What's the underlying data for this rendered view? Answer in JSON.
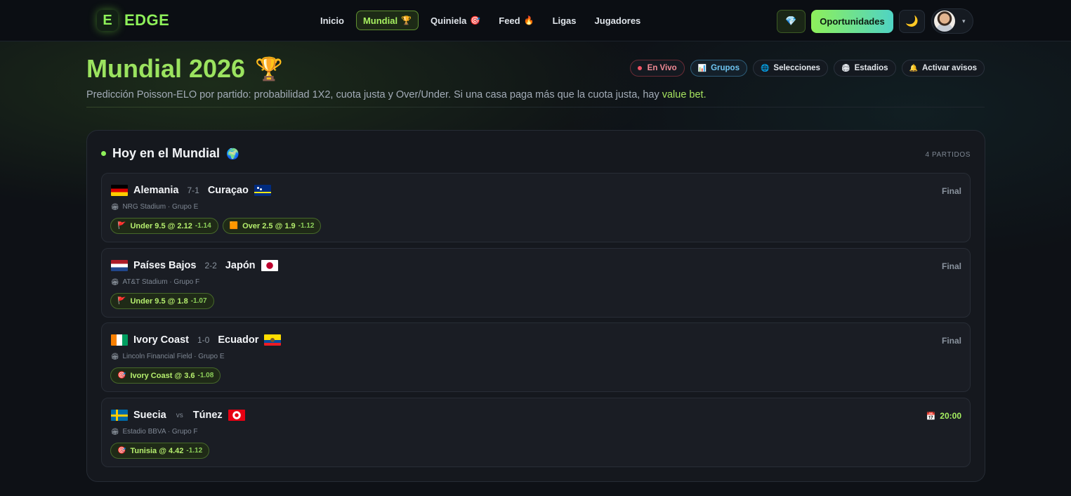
{
  "nav": {
    "logo_letter": "E",
    "logo_text": "EDGE",
    "items": [
      {
        "label": "Inicio",
        "emoji": ""
      },
      {
        "label": "Mundial",
        "emoji": "🏆"
      },
      {
        "label": "Quiniela",
        "emoji": "🎯"
      },
      {
        "label": "Feed",
        "emoji": "🔥"
      },
      {
        "label": "Ligas",
        "emoji": ""
      },
      {
        "label": "Jugadores",
        "emoji": ""
      }
    ],
    "active_item": "Mundial",
    "gem_icon": "💎",
    "opportunities_label": "Oportunidades",
    "moon_icon": "🌙",
    "caret": "▾"
  },
  "header": {
    "title": "Mundial 2026",
    "title_icon": "🏆",
    "subtitle_main": "Predicción Poisson-ELO por partido: probabilidad 1X2, cuota justa y Over/Under. Si una casa paga más que la cuota justa, hay ",
    "subtitle_highlight": "value bet.",
    "chips": {
      "live": "En Vivo",
      "groups": "Grupos",
      "groups_icon": "📊",
      "selections": "Selecciones",
      "selections_icon": "🌐",
      "stadiums": "Estadios",
      "stadiums_icon": "🏟",
      "alerts": "Activar avisos",
      "alerts_icon": "🔔"
    }
  },
  "today": {
    "title": "Hoy en el Mundial",
    "title_icon": "🌍",
    "count": "4 PARTIDOS",
    "venue_icon": "🏟",
    "matches": [
      {
        "home": "Alemania",
        "home_flag": "germany-flag",
        "score": "7-1",
        "away": "Curaçao",
        "away_flag": "curacao-flag",
        "venue": "NRG Stadium · Grupo E",
        "status": "Final",
        "tags": [
          {
            "icon": "🚩",
            "text": "Under 9.5 @ 2.12",
            "ev": "-1.14"
          },
          {
            "icon": "🟧",
            "text": "Over 2.5 @ 1.9",
            "ev": "-1.12"
          }
        ]
      },
      {
        "home": "Países Bajos",
        "home_flag": "netherlands-flag",
        "score": "2-2",
        "away": "Japón",
        "away_flag": "japan-flag",
        "venue": "AT&T Stadium · Grupo F",
        "status": "Final",
        "tags": [
          {
            "icon": "🚩",
            "text": "Under 9.5 @ 1.8",
            "ev": "-1.07"
          }
        ]
      },
      {
        "home": "Ivory Coast",
        "home_flag": "ivory-coast-flag",
        "score": "1-0",
        "away": "Ecuador",
        "away_flag": "ecuador-flag",
        "venue": "Lincoln Financial Field · Grupo E",
        "status": "Final",
        "tags": [
          {
            "icon": "🎯",
            "text": "Ivory Coast @ 3.6",
            "ev": "-1.08"
          }
        ]
      },
      {
        "home": "Suecia",
        "home_flag": "sweden-flag",
        "vs": "vs",
        "away": "Túnez",
        "away_flag": "tunisia-flag",
        "venue": "Estadio BBVA · Grupo F",
        "status_icon": "📅",
        "status": "20:00",
        "tags": [
          {
            "icon": "🎯",
            "text": "Tunisia @ 4.42",
            "ev": "-1.12"
          }
        ]
      }
    ]
  },
  "colors": {
    "accent_green": "#8ef05a",
    "live_red": "#f25466",
    "groups_blue": "#6fc6f2",
    "background": "#0e1116"
  }
}
